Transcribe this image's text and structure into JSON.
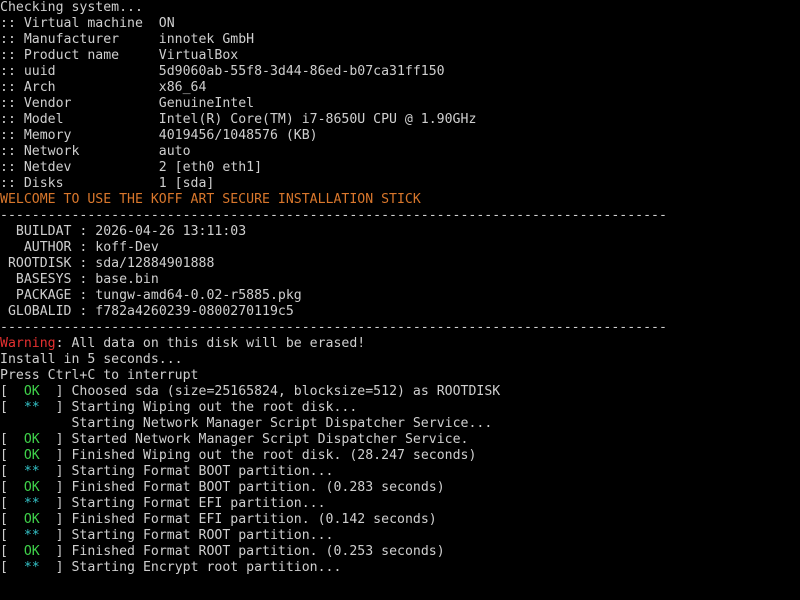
{
  "console": {
    "checking": "Checking system...",
    "system_info": [
      {
        "k": ":: Virtual machine",
        "v": "ON"
      },
      {
        "k": ":: Manufacturer",
        "v": "innotek GmbH"
      },
      {
        "k": ":: Product name",
        "v": "VirtualBox"
      },
      {
        "k": ":: uuid",
        "v": "5d9060ab-55f8-3d44-86ed-b07ca31ff150"
      },
      {
        "k": ":: Arch",
        "v": "x86_64"
      },
      {
        "k": ":: Vendor",
        "v": "GenuineIntel"
      },
      {
        "k": ":: Model",
        "v": "Intel(R) Core(TM) i7-8650U CPU @ 1.90GHz"
      },
      {
        "k": ":: Memory",
        "v": "4019456/1048576 (KB)"
      },
      {
        "k": ":: Network",
        "v": "auto"
      },
      {
        "k": ":: Netdev",
        "v": "2 [eth0 eth1]"
      },
      {
        "k": ":: Disks",
        "v": "1 [sda]"
      }
    ],
    "welcome": "WELCOME TO USE THE KOFF ART SECURE INSTALLATION STICK",
    "separator": "------------------------------------------------------------------------------------",
    "build_info": [
      {
        "k": "BUILDAT",
        "v": "2026-04-26 13:11:03"
      },
      {
        "k": "AUTHOR",
        "v": "koff-Dev"
      },
      {
        "k": "ROOTDISK",
        "v": "sda/12884901888"
      },
      {
        "k": "BASESYS",
        "v": "base.bin"
      },
      {
        "k": "PACKAGE",
        "v": "tungw-amd64-0.02-r5885.pkg"
      },
      {
        "k": "GLOBALID",
        "v": "f782a4260239-0800270119c5"
      }
    ],
    "warning_label": "Warning",
    "warning_text": ": All data on this disk will be erased!",
    "install_countdown": "Install in 5 seconds...",
    "interrupt_hint": "Press Ctrl+C to interrupt",
    "log": [
      {
        "status": "OK",
        "text": "Choosed sda (size=25165824, blocksize=512) as ROOTDISK"
      },
      {
        "status": "**",
        "text": "Starting Wiping out the root disk..."
      },
      {
        "status": "",
        "text": "Starting Network Manager Script Dispatcher Service..."
      },
      {
        "status": "OK",
        "text": "Started Network Manager Script Dispatcher Service."
      },
      {
        "status": "OK",
        "text": "Finished Wiping out the root disk. (28.247 seconds)"
      },
      {
        "status": "**",
        "text": "Starting Format BOOT partition..."
      },
      {
        "status": "OK",
        "text": "Finished Format BOOT partition. (0.283 seconds)"
      },
      {
        "status": "**",
        "text": "Starting Format EFI partition..."
      },
      {
        "status": "OK",
        "text": "Finished Format EFI partition. (0.142 seconds)"
      },
      {
        "status": "**",
        "text": "Starting Format ROOT partition..."
      },
      {
        "status": "OK",
        "text": "Finished Format ROOT partition. (0.253 seconds)"
      },
      {
        "status": "**",
        "text": "Starting Encrypt root partition..."
      }
    ]
  },
  "colors": {
    "background": "#000000",
    "text": "#cfcfcf",
    "ok": "#3fd24a",
    "in_progress": "#34c3c8",
    "warning": "#e53030",
    "banner": "#d9772c"
  }
}
